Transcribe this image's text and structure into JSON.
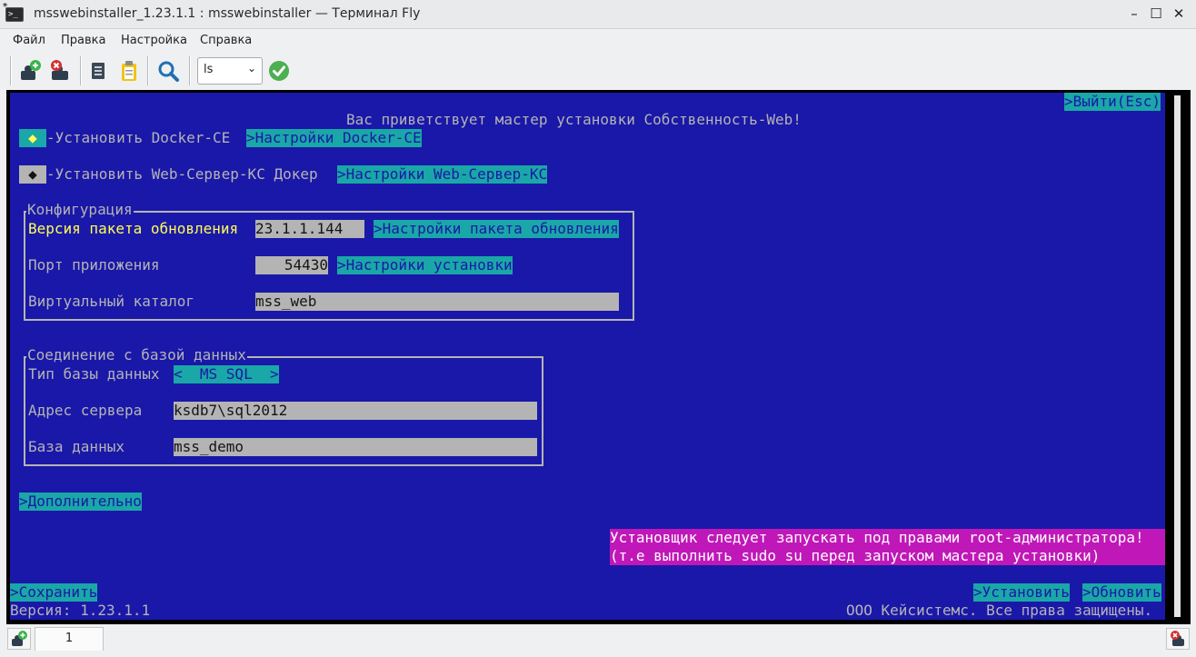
{
  "window": {
    "title": "msswebinstaller_1.23.1.1 : msswebinstaller — Терминал Fly",
    "icon_label": ">_",
    "icon_badge": "*",
    "controls": {
      "minimize": "–",
      "maximize": "☐",
      "close": "✕"
    }
  },
  "menubar": [
    "Файл",
    "Правка",
    "Настройка",
    "Справка"
  ],
  "toolbar": {
    "icons": [
      "new-session-icon",
      "close-session-icon",
      "copy-icon",
      "paste-icon",
      "search-icon",
      "run-icon"
    ],
    "command_value": "ls",
    "chevron": "⌄"
  },
  "terminal": {
    "exit_button": ">Выйти(Esc)",
    "welcome": "Вас приветствует мастер установки Собственность-Web!",
    "docker": {
      "mark": "◆",
      "label": "-Установить Docker-CE",
      "settings": ">Настройки Docker-CE"
    },
    "webserver": {
      "mark": "◆",
      "label": "-Установить Web-Сервер-КС Докер",
      "settings": ">Настройки Web-Сервер-КС"
    },
    "config": {
      "legend": "Конфигурация",
      "version_label": "Версия пакета обновления",
      "version_value": "23.1.1.144",
      "version_settings": ">Настройки пакета обновления",
      "port_label": "Порт приложения",
      "port_value": "54430",
      "port_settings": ">Настройки установки",
      "vdir_label": "Виртуальный каталог",
      "vdir_value": "mss_web"
    },
    "db": {
      "legend": "Соединение с базой данных",
      "type_label": "Тип базы данных",
      "type_value": "<  MS SQL  >",
      "server_label": "Адрес сервера",
      "server_value": "ksdb7\\sql2012",
      "name_label": "База данных",
      "name_value": "mss_demo"
    },
    "advanced_button": ">Дополнительно",
    "warning_line1": "Установщик следует запускать под правами root-администратора!",
    "warning_line2": "(т.е выполнить sudo su перед запуском мастера установки)",
    "save_button": ">Сохранить",
    "install_button": ">Установить",
    "update_button": ">Обновить",
    "version_text": "Версия: 1.23.1.1",
    "copyright": "ООО Кейсистемс. Все права защищены."
  },
  "statusbar": {
    "tab_label": "1"
  },
  "colors": {
    "terminal_bg": "#1a18a8",
    "button_bg": "#1aa7a7",
    "warning_bg": "#c018b8",
    "field_bg": "#b4b4b4",
    "highlight": "#ffff55"
  }
}
